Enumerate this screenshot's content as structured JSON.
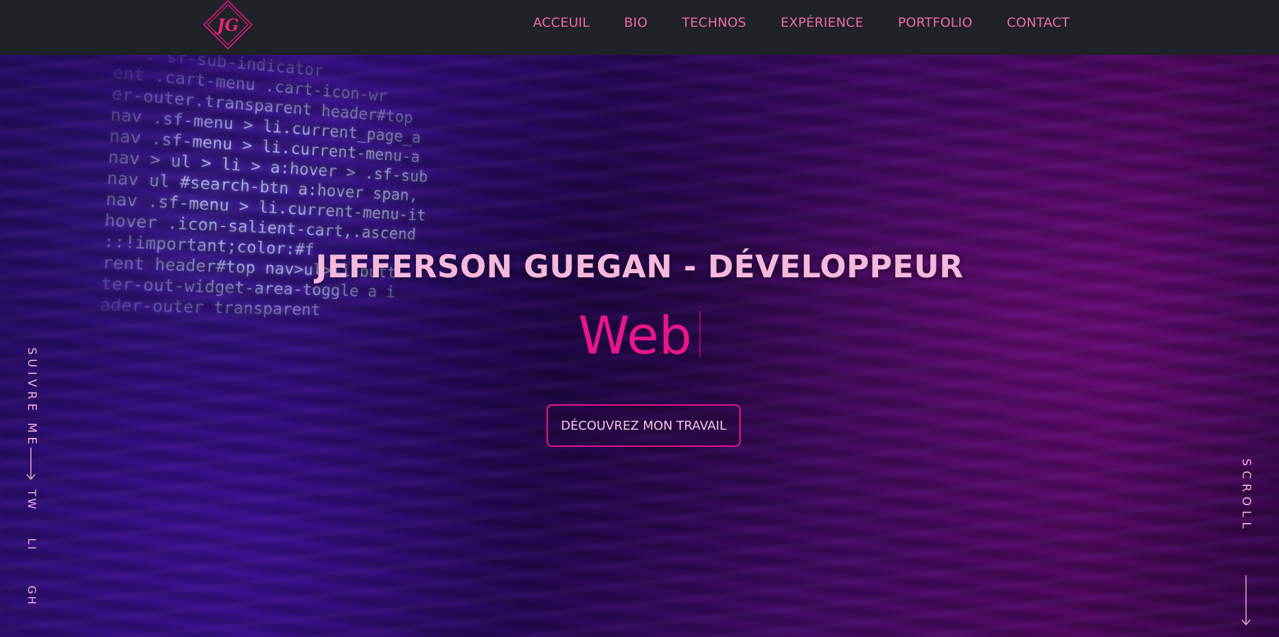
{
  "brand": {
    "logo_text": "JG",
    "accent_color": "#e8168a",
    "nav_background": "#1f2226"
  },
  "nav": {
    "items": [
      {
        "label": "ACCEUIL"
      },
      {
        "label": "BIO"
      },
      {
        "label": "TECHNOS"
      },
      {
        "label": "EXPÉRIENCE"
      },
      {
        "label": "PORTFOLIO"
      },
      {
        "label": "CONTACT"
      }
    ]
  },
  "hero": {
    "title": "JEFFERSON GUEGAN - DÉVELOPPEUR",
    "typed_word": "Web",
    "cta_label": "DÉCOUVREZ MON TRAVAIL",
    "background_code": [
      ".  . sf-sub-indicator",
      "ent .cart-menu .cart-icon-wr",
      "er-outer.transparent header#top",
      "nav .sf-menu > li.current_page_a",
      "nav .sf-menu > li.current-menu-a",
      "nav > ul > li > a:hover > .sf-sub",
      "nav ul #search-btn a:hover span,",
      "nav .sf-menu > li.current-menu-it",
      "hover .icon-salient-cart,.ascend",
      "::!important;color:#f",
      "rent header#top nav>ul>li.butt",
      "ter-out-widget-area-toggle a i",
      "ader-outer transparent"
    ]
  },
  "social": {
    "follow_label": "SUIVRE ME",
    "arrow_icon": "arrow-down-icon",
    "links": [
      {
        "label": "TW"
      },
      {
        "label": "LI"
      },
      {
        "label": "GH"
      }
    ]
  },
  "scroll": {
    "label": "SCROLL",
    "arrow_icon": "arrow-down-icon"
  }
}
